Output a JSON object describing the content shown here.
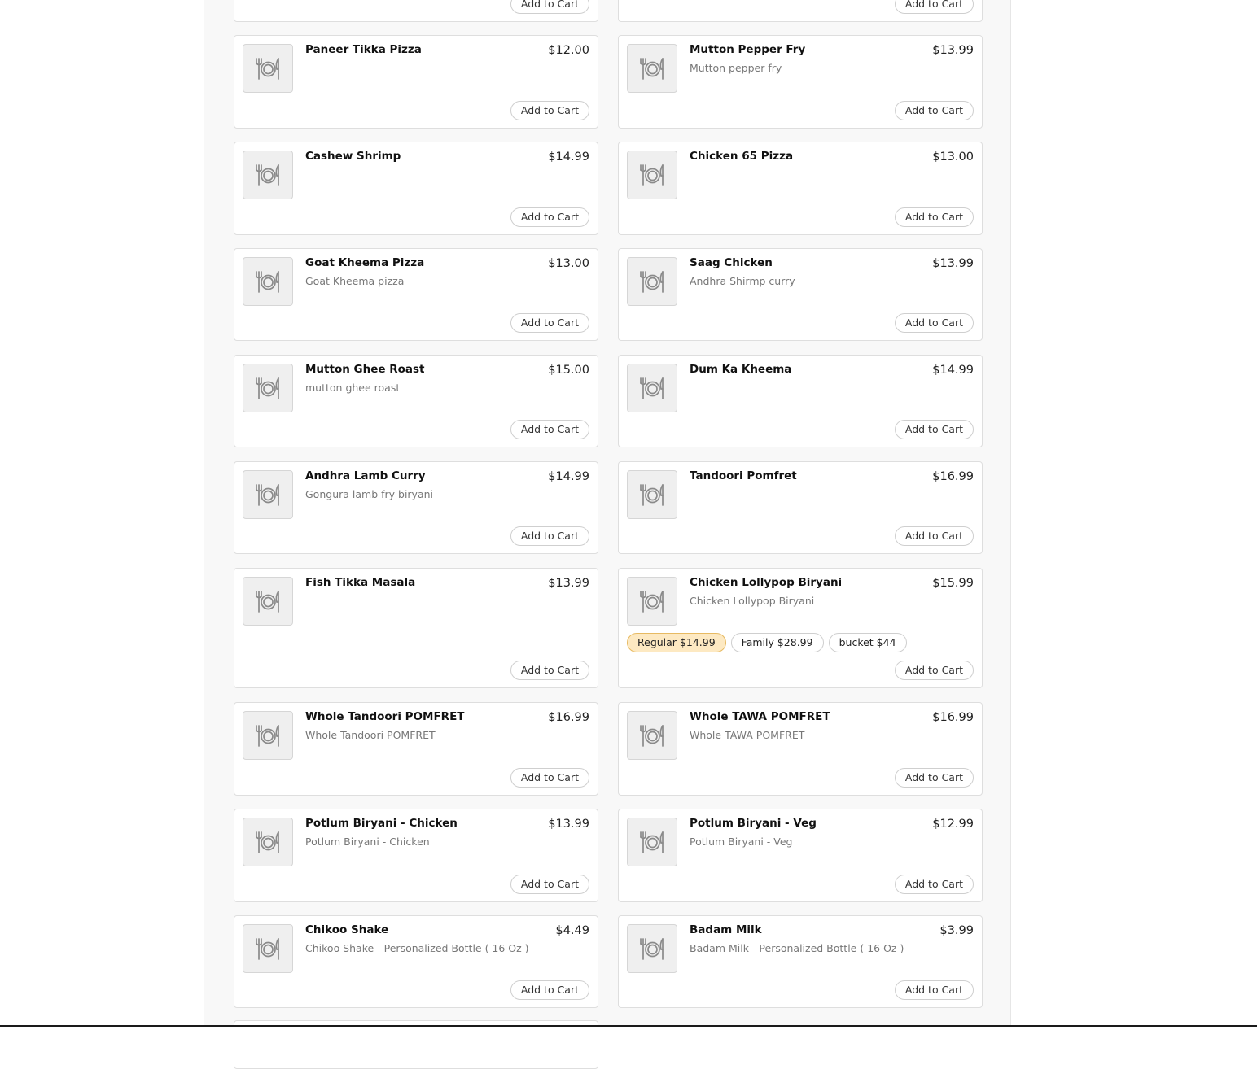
{
  "cart_label": "Add to Cart",
  "thumb_icon": "plate-fork-knife-icon",
  "colors": {
    "selected_option_bg": "#fde9c2",
    "selected_option_border": "#e7ba62"
  },
  "menu": [
    {
      "name": "Paneer Tikka Pizza",
      "description": "",
      "price": "$12.00"
    },
    {
      "name": "Mutton Pepper Fry",
      "description": "Mutton pepper fry",
      "price": "$13.99"
    },
    {
      "name": "Cashew Shrimp",
      "description": "",
      "price": "$14.99"
    },
    {
      "name": "Chicken 65 Pizza",
      "description": "",
      "price": "$13.00"
    },
    {
      "name": "Goat Kheema Pizza",
      "description": "Goat Kheema pizza",
      "price": "$13.00"
    },
    {
      "name": "Saag Chicken",
      "description": "Andhra Shirmp curry",
      "price": "$13.99"
    },
    {
      "name": "Mutton Ghee Roast",
      "description": "mutton ghee roast",
      "price": "$15.00"
    },
    {
      "name": "Dum Ka Kheema",
      "description": "",
      "price": "$14.99"
    },
    {
      "name": "Andhra Lamb Curry",
      "description": "Gongura lamb fry biryani",
      "price": "$14.99"
    },
    {
      "name": "Tandoori Pomfret",
      "description": "",
      "price": "$16.99"
    },
    {
      "name": "Fish Tikka Masala",
      "description": "",
      "price": "$13.99"
    },
    {
      "name": "Chicken Lollypop Biryani",
      "description": "Chicken Lollypop Biryani",
      "price": "$15.99",
      "options": [
        {
          "label": "Regular $14.99",
          "selected": true
        },
        {
          "label": "Family $28.99",
          "selected": false
        },
        {
          "label": "bucket $44",
          "selected": false
        }
      ]
    },
    {
      "name": "Whole Tandoori POMFRET",
      "description": "Whole Tandoori POMFRET",
      "price": "$16.99"
    },
    {
      "name": "Whole TAWA POMFRET",
      "description": "Whole TAWA POMFRET",
      "price": "$16.99"
    },
    {
      "name": "Potlum Biryani - Chicken",
      "description": "Potlum Biryani - Chicken",
      "price": "$13.99"
    },
    {
      "name": "Potlum Biryani - Veg",
      "description": "Potlum Biryani - Veg",
      "price": "$12.99"
    },
    {
      "name": "Chikoo Shake",
      "description": "Chikoo Shake - Personalized Bottle ( 16 Oz )",
      "price": "$4.49"
    },
    {
      "name": "Badam Milk",
      "description": "Badam Milk - Personalized Bottle ( 16 Oz )",
      "price": "$3.99"
    }
  ]
}
